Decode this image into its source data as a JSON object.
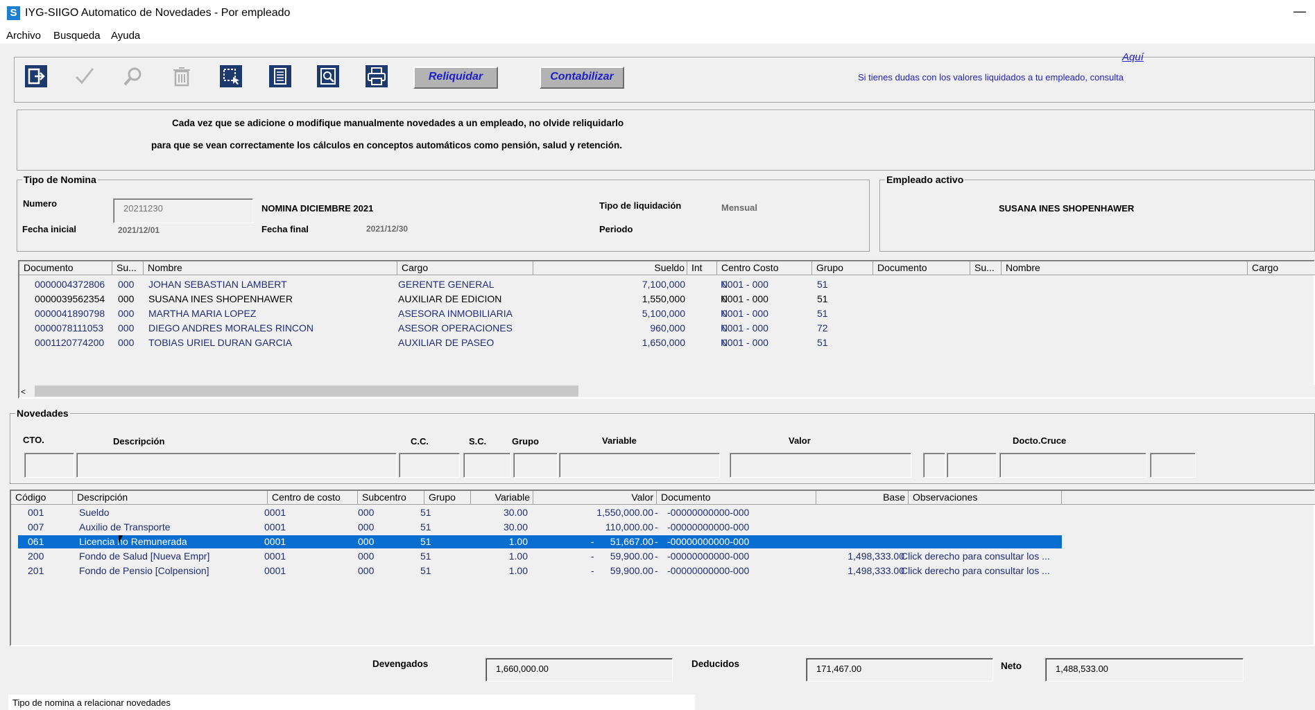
{
  "window": {
    "title": "IYG-SIIGO Automatico de Novedades - Por empleado",
    "minimize": "—"
  },
  "menu": [
    "Archivo",
    "Busqueda",
    "Ayuda"
  ],
  "toolbar": {
    "icons": [
      "exit-icon",
      "check-icon",
      "search-icon",
      "trash-icon",
      "select-icon",
      "document-icon",
      "preview-icon",
      "print-icon"
    ],
    "reliquidar": "Reliquidar",
    "contabilizar": "Contabilizar",
    "help_link": "Aquí",
    "help_text": "Si tienes dudas con los valores liquidados a tu empleado, consulta"
  },
  "notice": {
    "line1": "Cada vez que se adicione o modifique manualmente novedades a un empleado, no olvide reliquidarlo",
    "line2": "para que se vean correctamente los cálculos en conceptos automáticos como pensión, salud y retención."
  },
  "tipo_nomina": {
    "group": "Tipo de Nomina",
    "numero_label": "Numero",
    "numero": "20211230",
    "nombre": "NOMINA DICIEMBRE 2021",
    "tipo_liq_label": "Tipo de liquidación",
    "tipo_liq": "Mensual",
    "fecha_inicial_label": "Fecha inicial",
    "fecha_inicial": "2021/12/01",
    "fecha_final_label": "Fecha final",
    "fecha_final": "2021/12/30",
    "periodo_label": "Periodo"
  },
  "empleado": {
    "group": "Empleado activo",
    "nombre": "SUSANA INES SHOPENHAWER"
  },
  "employees": {
    "headers": [
      "Documento",
      "Su...",
      "Nombre",
      "Cargo",
      "Sueldo",
      "Int",
      "Centro Costo",
      "Grupo",
      "Documento",
      "Su...",
      "Nombre",
      "Cargo"
    ],
    "rows": [
      [
        "0000004372806",
        "000",
        "JOHAN SEBASTIAN LAMBERT",
        "GERENTE GENERAL",
        "7,100,000",
        "N",
        "0001 - 000",
        "51"
      ],
      [
        "0000039562354",
        "000",
        "SUSANA INES SHOPENHAWER",
        "AUXILIAR DE EDICION",
        "1,550,000",
        "N",
        "0001 - 000",
        "51"
      ],
      [
        "0000041890798",
        "000",
        "MARTHA MARIA LOPEZ",
        "ASESORA INMOBILIARIA",
        "5,100,000",
        "N",
        "0001 - 000",
        "51"
      ],
      [
        "0000078111053",
        "000",
        "DIEGO ANDRES MORALES RINCON",
        "ASESOR OPERACIONES",
        "960,000",
        "N",
        "0001 - 000",
        "72"
      ],
      [
        "0001120774200",
        "000",
        "TOBIAS URIEL DURAN GARCIA",
        "AUXILIAR DE PASEO",
        "1,650,000",
        "N",
        "0001 - 000",
        "51"
      ]
    ],
    "selected_row": 1
  },
  "novedades": {
    "group": "Novedades",
    "labels": {
      "cto": "CTO.",
      "descripcion": "Descripción",
      "cc": "C.C.",
      "sc": "S.C.",
      "grupo": "Grupo",
      "variable": "Variable",
      "valor": "Valor",
      "docto_cruce": "Docto.Cruce"
    }
  },
  "detail": {
    "headers": [
      "Código",
      "Descripción",
      "Centro de costo",
      "Subcentro",
      "Grupo",
      "Variable",
      "Valor",
      "Documento",
      "Base",
      "Observaciones"
    ],
    "rows": [
      [
        "001",
        "Sueldo",
        "0001",
        "000",
        "51",
        "30.00",
        "",
        "1,550,000.00",
        "-",
        "-00000000000-000",
        "",
        ""
      ],
      [
        "007",
        "Auxilio de Transporte",
        "0001",
        "000",
        "51",
        "30.00",
        "",
        "110,000.00",
        "-",
        "-00000000000-000",
        "",
        ""
      ],
      [
        "061",
        "Licencia no Remunerada",
        "0001",
        "000",
        "51",
        "1.00",
        "-",
        "51,667.00",
        "-",
        "-00000000000-000",
        "",
        ""
      ],
      [
        "200",
        "Fondo de Salud  [Nueva Empr]",
        "0001",
        "000",
        "51",
        "1.00",
        "-",
        "59,900.00",
        "-",
        "-00000000000-000",
        "1,498,333.00",
        "Click derecho para consultar los ..."
      ],
      [
        "201",
        "Fondo de Pensio [Colpension]",
        "0001",
        "000",
        "51",
        "1.00",
        "-",
        "59,900.00",
        "-",
        "-00000000000-000",
        "1,498,333.00",
        "Click derecho para consultar los ..."
      ]
    ],
    "selected_row": 2
  },
  "totals": {
    "devengados_label": "Devengados",
    "devengados": "1,660,000.00",
    "deducidos_label": "Deducidos",
    "deducidos": "171,467.00",
    "neto_label": "Neto",
    "neto": "1,488,533.00"
  },
  "status": "Tipo de nomina a relacionar novedades"
}
